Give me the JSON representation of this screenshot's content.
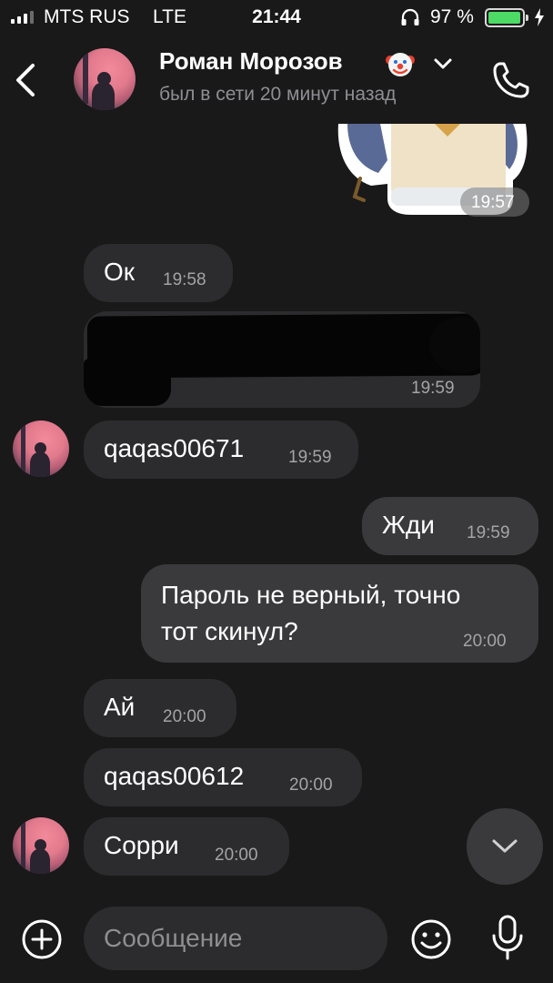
{
  "status_bar": {
    "carrier": "MTS RUS",
    "network": "LTE",
    "time": "21:44",
    "battery": "97 %",
    "battery_level": 0.97
  },
  "header": {
    "contact_name": "Роман Морозов",
    "contact_status": "был в сети 20 минут назад",
    "name_emoji_icon": "clown-face-icon",
    "back_icon": "chevron-left-icon",
    "call_icon": "phone-icon"
  },
  "messages": {
    "sticker": {
      "time": "19:57"
    },
    "m1": {
      "text": "Ок",
      "time": "19:58"
    },
    "m2": {
      "time": "19:59"
    },
    "m3": {
      "text": "qaqas00671",
      "time": "19:59"
    },
    "m4": {
      "text": "Жди",
      "time": "19:59"
    },
    "m5": {
      "line1": "Пароль не верный, точно",
      "line2": "тот скинул?",
      "time": "20:00"
    },
    "m6": {
      "text": "Ай",
      "time": "20:00"
    },
    "m7": {
      "text": "qaqas00612",
      "time": "20:00"
    },
    "m8": {
      "text": "Сорри",
      "time": "20:00"
    }
  },
  "input_bar": {
    "placeholder": "Сообщение",
    "value": "",
    "icons": [
      "plus-circle-icon",
      "smile-icon",
      "microphone-icon"
    ]
  },
  "colors": {
    "background": "#19191a",
    "incoming_bubble": "#2c2c2e",
    "outgoing_bubble": "#3a3a3c",
    "secondary_text": "#8e8e93",
    "battery_green": "#4cd964"
  }
}
